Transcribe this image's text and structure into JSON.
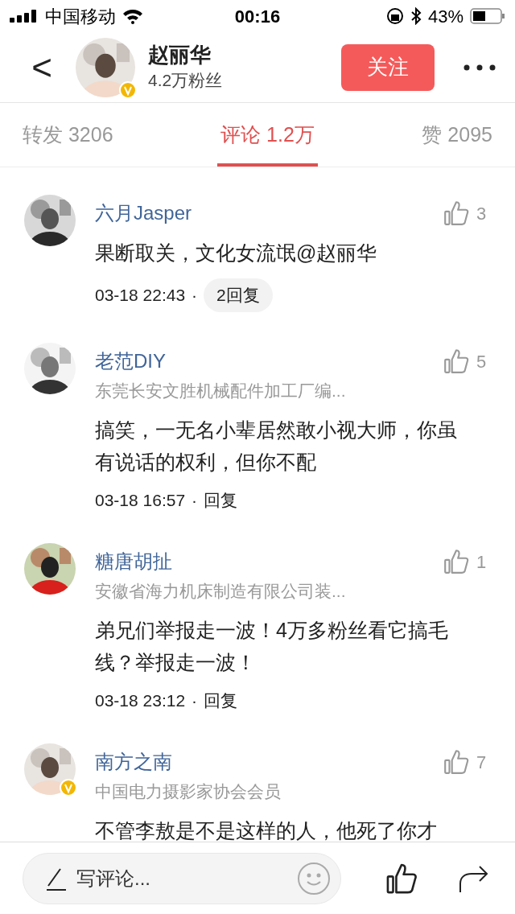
{
  "status_bar": {
    "carrier": "中国移动",
    "time": "00:16",
    "battery": "43%"
  },
  "header": {
    "back": "<",
    "name": "赵丽华",
    "followers": "4.2万粉丝",
    "verified": true,
    "follow_button": "关注"
  },
  "tabs": [
    {
      "label": "转发 3206",
      "selected": false
    },
    {
      "label": "评论 1.2万",
      "selected": true
    },
    {
      "label": "赞 2095",
      "selected": false
    }
  ],
  "comments": [
    {
      "name": "六月Jasper",
      "verified": false,
      "likes": "3",
      "text": "果断取关，文化女流氓@赵丽华",
      "time": "03-18 22:43",
      "dot": "·",
      "reply": {
        "label": "2回复",
        "kind": "pill"
      }
    },
    {
      "name": "老范DIY",
      "verified": false,
      "subtitle": "东莞长安文胜机械配件加工厂编...",
      "likes": "5",
      "text": "搞笑，一无名小辈居然敢小视大师，你虽有说话的权利，但你不配",
      "time": "03-18 16:57",
      "dot": "·",
      "reply": {
        "label": "回复",
        "kind": "plain"
      }
    },
    {
      "name": "糖唐胡扯",
      "verified": false,
      "subtitle": "安徽省海力机床制造有限公司装...",
      "likes": "1",
      "text": "弟兄们举报走一波！4万多粉丝看它搞毛线？举报走一波！",
      "time": "03-18 23:12",
      "dot": "·",
      "reply": {
        "label": "回复",
        "kind": "plain"
      }
    },
    {
      "name": "南方之南",
      "verified": true,
      "subtitle": "中国电力摄影家协会会员",
      "likes": "7",
      "text": "不管李敖是不是这样的人，他死了你才"
    }
  ],
  "bottom_bar": {
    "placeholder": "写评论..."
  }
}
